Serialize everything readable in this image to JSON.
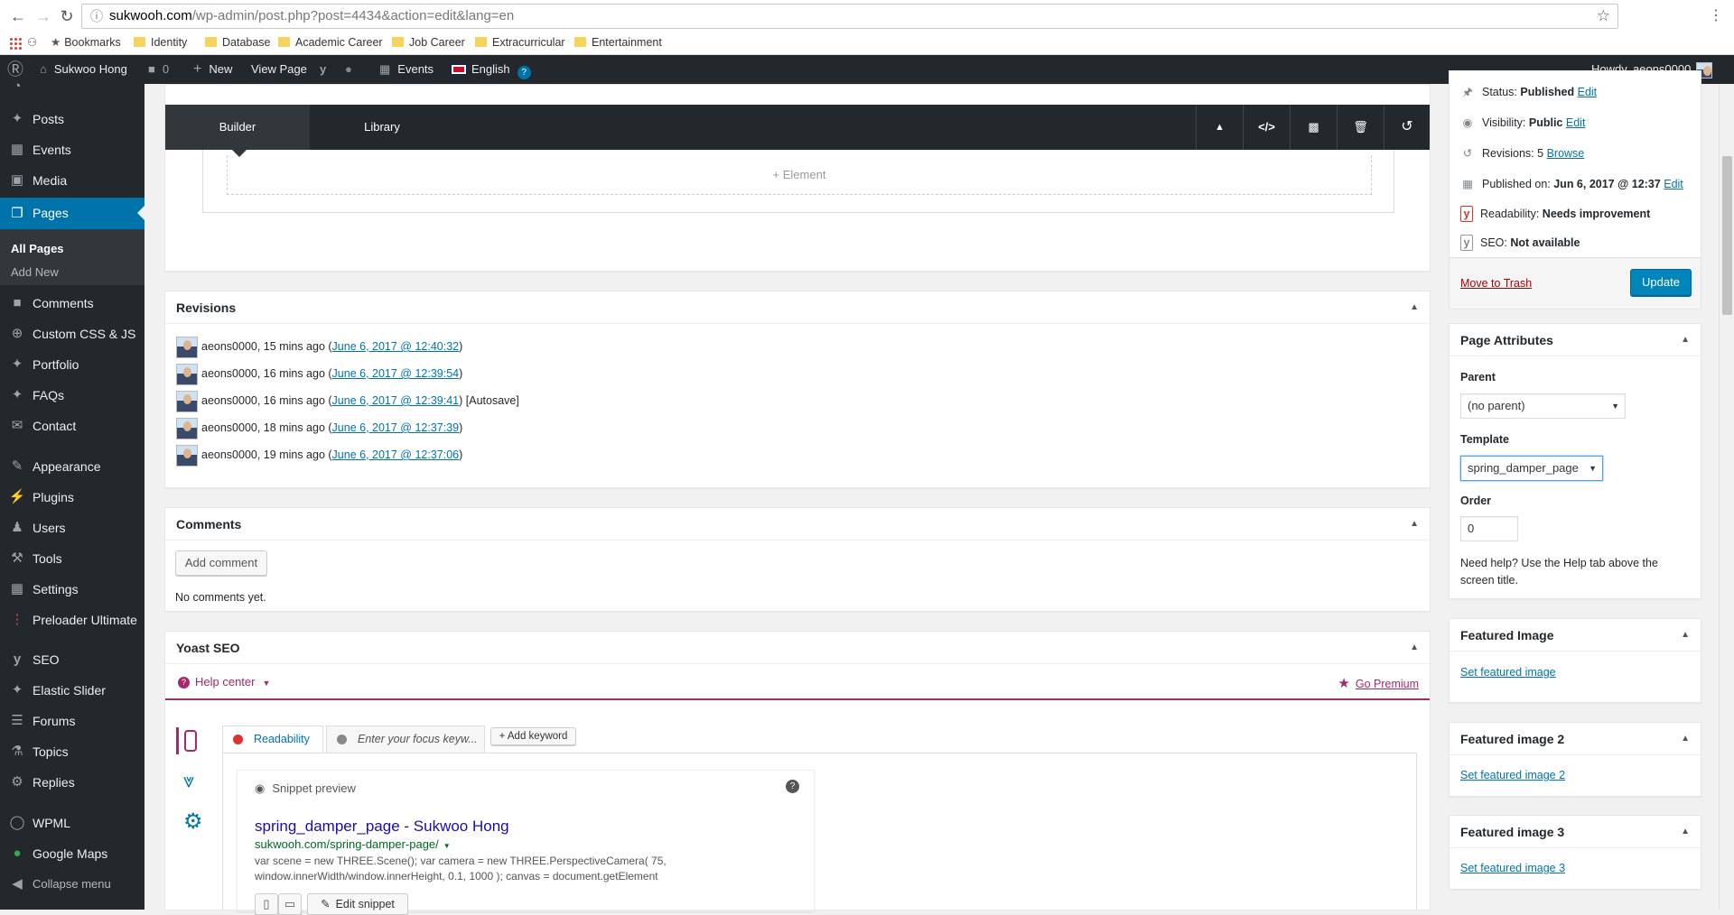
{
  "browser": {
    "url_host": "sukwooh.com",
    "url_rest": "/wp-admin/post.php?post=4434&action=edit&lang=en",
    "bookmarks": [
      {
        "label": "Bookmarks",
        "icon": "star-icon"
      },
      {
        "label": "Identity",
        "icon": "folder-icon"
      },
      {
        "label": "Database",
        "icon": "folder-icon"
      },
      {
        "label": "Academic Career",
        "icon": "folder-icon"
      },
      {
        "label": "Job Career",
        "icon": "folder-icon"
      },
      {
        "label": "Extracurricular",
        "icon": "folder-icon"
      },
      {
        "label": "Entertainment",
        "icon": "folder-icon"
      }
    ]
  },
  "adminbar": {
    "site": "Sukwoo Hong",
    "comments_count": "0",
    "new": "New",
    "view_page": "View Page",
    "events": "Events",
    "language": "English",
    "howdy": "Howdy, aeons0000"
  },
  "sidebar": {
    "items": [
      {
        "label": "Posts",
        "icon": "pin-icon"
      },
      {
        "label": "Events",
        "icon": "calendar-icon"
      },
      {
        "label": "Media",
        "icon": "media-icon"
      },
      {
        "label": "Pages",
        "icon": "pages-icon"
      },
      {
        "label": "Comments",
        "icon": "comment-icon"
      },
      {
        "label": "Custom CSS & JS",
        "icon": "plus-circle-icon"
      },
      {
        "label": "Portfolio",
        "icon": "pin-icon"
      },
      {
        "label": "FAQs",
        "icon": "pin-icon"
      },
      {
        "label": "Contact",
        "icon": "mail-icon"
      },
      {
        "label": "Appearance",
        "icon": "brush-icon"
      },
      {
        "label": "Plugins",
        "icon": "plug-icon"
      },
      {
        "label": "Users",
        "icon": "user-icon"
      },
      {
        "label": "Tools",
        "icon": "wrench-icon"
      },
      {
        "label": "Settings",
        "icon": "settings-icon"
      },
      {
        "label": "Preloader Ultimate",
        "icon": "dots-icon"
      },
      {
        "label": "SEO",
        "icon": "yoast-icon"
      },
      {
        "label": "Elastic Slider",
        "icon": "pin-icon"
      },
      {
        "label": "Forums",
        "icon": "forum-icon"
      },
      {
        "label": "Topics",
        "icon": "topic-icon"
      },
      {
        "label": "Replies",
        "icon": "reply-icon"
      },
      {
        "label": "WPML",
        "icon": "wpml-icon"
      },
      {
        "label": "Google Maps",
        "icon": "map-pin-icon"
      },
      {
        "label": "Collapse menu",
        "icon": "collapse-icon"
      }
    ],
    "submenu": {
      "all_pages": "All Pages",
      "add_new": "Add New"
    }
  },
  "builder": {
    "tabs": [
      "Builder",
      "Library"
    ],
    "add_element": "+ Element"
  },
  "revisions": {
    "title": "Revisions",
    "rows": [
      {
        "author": "aeons0000, 15 mins ago (",
        "date": "June 6, 2017 @ 12:40:32",
        "suffix": ")"
      },
      {
        "author": "aeons0000, 16 mins ago (",
        "date": "June 6, 2017 @ 12:39:54",
        "suffix": ")"
      },
      {
        "author": "aeons0000, 16 mins ago (",
        "date": "June 6, 2017 @ 12:39:41",
        "suffix": ") [Autosave]"
      },
      {
        "author": "aeons0000, 18 mins ago (",
        "date": "June 6, 2017 @ 12:37:39",
        "suffix": ")"
      },
      {
        "author": "aeons0000, 19 mins ago (",
        "date": "June 6, 2017 @ 12:37:06",
        "suffix": ")"
      }
    ]
  },
  "comments": {
    "title": "Comments",
    "add": "Add comment",
    "empty": "No comments yet."
  },
  "yoast": {
    "title": "Yoast SEO",
    "help": "Help center",
    "premium": "Go Premium",
    "readability_tab": "Readability",
    "focus_placeholder": "Enter your focus keyw...",
    "add_keyword": "+ Add keyword",
    "snippet_label": "Snippet preview",
    "snippet_title_page": "spring_damper_page",
    "snippet_title_site": " - Sukwoo Hong",
    "snippet_url": "sukwooh.com/spring-damper-page/",
    "snippet_desc1": "var scene = new THREE.Scene(); var camera = new THREE.PerspectiveCamera( 75,",
    "snippet_desc2": "window.innerWidth/window.innerHeight, 0.1, 1000 ); canvas = document.getElement",
    "edit_snippet": "Edit snippet"
  },
  "publish": {
    "status_label": "Status: ",
    "status": "Published",
    "edit": "Edit",
    "visibility_label": "Visibility: ",
    "visibility": "Public",
    "revisions_label": "Revisions: 5 ",
    "browse": "Browse",
    "published_on_label": "Published on: ",
    "published_on": "Jun 6, 2017 @ 12:37",
    "readability_label": "Readability: ",
    "readability": "Needs improvement",
    "seo_label": "SEO: ",
    "seo": "Not available",
    "trash": "Move to Trash",
    "update": "Update"
  },
  "attributes": {
    "title": "Page Attributes",
    "parent_label": "Parent",
    "parent": "(no parent)",
    "template_label": "Template",
    "template": "spring_damper_page",
    "order_label": "Order",
    "order": "0",
    "help": "Need help? Use the Help tab above the screen title."
  },
  "featured": [
    {
      "title": "Featured Image",
      "link": "Set featured image"
    },
    {
      "title": "Featured image 2",
      "link": "Set featured image 2"
    },
    {
      "title": "Featured image 3",
      "link": "Set featured image 3"
    }
  ],
  "colors": {
    "admin_dark": "#23282d",
    "accent": "#0073aa",
    "yoast_red": "#dc3232",
    "yoast_purple": "#a4286a"
  }
}
